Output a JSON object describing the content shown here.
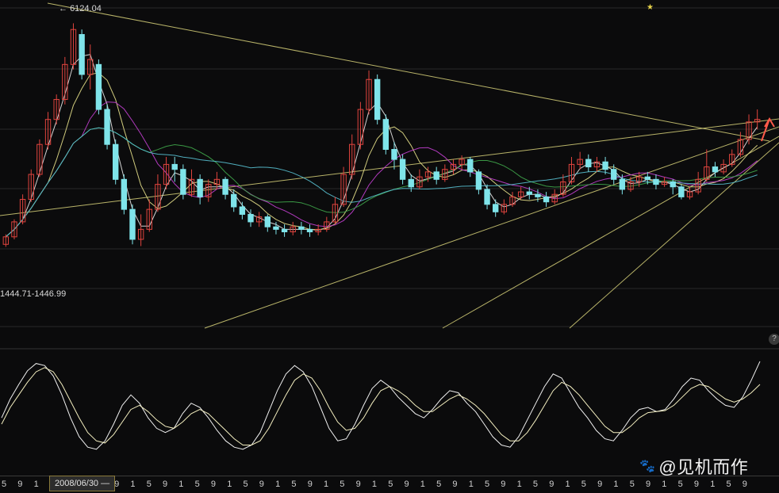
{
  "header": {
    "peak_label": "6124.04",
    "low_label": "1444.71-1446.99",
    "star": "★",
    "help": "?"
  },
  "watermark": {
    "icon": "paw-icon",
    "text": "@见机而作"
  },
  "axis": {
    "current_date": "2008/06/30 —",
    "tick_labels": [
      "5",
      "9",
      "1",
      "5",
      "9",
      "1",
      "5",
      "9",
      "1",
      "5",
      "9",
      "1",
      "5",
      "9",
      "1",
      "5",
      "9",
      "1",
      "5",
      "9",
      "1",
      "5",
      "9",
      "1",
      "5",
      "9",
      "1",
      "5",
      "9",
      "1",
      "5",
      "9",
      "1",
      "5",
      "9",
      "1",
      "5",
      "9",
      "1",
      "5",
      "9",
      "1",
      "5",
      "9",
      "1",
      "5",
      "9"
    ]
  },
  "colors": {
    "background": "#0b0b0c",
    "up": "#e0443e",
    "down": "#7fe4ea",
    "ma_white": "#e8e8e8",
    "ma_yellow": "#e6e08a",
    "ma_magenta": "#c23fd0",
    "ma_green": "#3fa64a",
    "ma_cyan": "#58c0d0",
    "trendline": "#d8d27a",
    "kdj_k": "#f0f0f0",
    "kdj_d": "#f4efc0"
  },
  "chart_data": {
    "type": "candlestick",
    "title": "",
    "annotations": [
      "6124.04",
      "1444.71-1446.99"
    ],
    "ylim": [
      800,
      6400
    ],
    "candles": [
      {
        "o": 1700,
        "c": 1850,
        "h": 1900,
        "l": 1650
      },
      {
        "o": 1850,
        "c": 2150,
        "h": 2200,
        "l": 1800
      },
      {
        "o": 2150,
        "c": 2600,
        "h": 2700,
        "l": 2100
      },
      {
        "o": 2600,
        "c": 3100,
        "h": 3200,
        "l": 2550
      },
      {
        "o": 3100,
        "c": 3700,
        "h": 3800,
        "l": 3050
      },
      {
        "o": 3700,
        "c": 4200,
        "h": 4350,
        "l": 3600
      },
      {
        "o": 4200,
        "c": 4600,
        "h": 4700,
        "l": 4100
      },
      {
        "o": 4600,
        "c": 5300,
        "h": 5450,
        "l": 4500
      },
      {
        "o": 5300,
        "c": 6000,
        "h": 6124,
        "l": 5200
      },
      {
        "o": 5900,
        "c": 5100,
        "h": 6000,
        "l": 5000
      },
      {
        "o": 5100,
        "c": 5400,
        "h": 5700,
        "l": 4800
      },
      {
        "o": 5300,
        "c": 4400,
        "h": 5400,
        "l": 4300
      },
      {
        "o": 4400,
        "c": 3700,
        "h": 4500,
        "l": 3600
      },
      {
        "o": 3700,
        "c": 3000,
        "h": 3800,
        "l": 2900
      },
      {
        "o": 3000,
        "c": 2400,
        "h": 3100,
        "l": 2300
      },
      {
        "o": 2400,
        "c": 1800,
        "h": 2500,
        "l": 1700
      },
      {
        "o": 1800,
        "c": 2000,
        "h": 2300,
        "l": 1665
      },
      {
        "o": 2000,
        "c": 2400,
        "h": 2600,
        "l": 1950
      },
      {
        "o": 2400,
        "c": 2900,
        "h": 3100,
        "l": 2350
      },
      {
        "o": 2900,
        "c": 3300,
        "h": 3450,
        "l": 2800
      },
      {
        "o": 3300,
        "c": 3200,
        "h": 3450,
        "l": 2950
      },
      {
        "o": 3200,
        "c": 2700,
        "h": 3300,
        "l": 2600
      },
      {
        "o": 2700,
        "c": 3000,
        "h": 3200,
        "l": 2650
      },
      {
        "o": 3000,
        "c": 2650,
        "h": 3100,
        "l": 2500
      },
      {
        "o": 2650,
        "c": 2900,
        "h": 3000,
        "l": 2550
      },
      {
        "o": 2900,
        "c": 3000,
        "h": 3150,
        "l": 2800
      },
      {
        "o": 3000,
        "c": 2700,
        "h": 3050,
        "l": 2600
      },
      {
        "o": 2700,
        "c": 2450,
        "h": 2800,
        "l": 2350
      },
      {
        "o": 2450,
        "c": 2300,
        "h": 2550,
        "l": 2200
      },
      {
        "o": 2300,
        "c": 2150,
        "h": 2400,
        "l": 2050
      },
      {
        "o": 2150,
        "c": 2250,
        "h": 2350,
        "l": 2050
      },
      {
        "o": 2250,
        "c": 2050,
        "h": 2300,
        "l": 1950
      },
      {
        "o": 2050,
        "c": 2000,
        "h": 2150,
        "l": 1900
      },
      {
        "o": 2000,
        "c": 1950,
        "h": 2100,
        "l": 1850
      },
      {
        "o": 1950,
        "c": 2050,
        "h": 2150,
        "l": 1880
      },
      {
        "o": 2050,
        "c": 2000,
        "h": 2150,
        "l": 1900
      },
      {
        "o": 2000,
        "c": 1950,
        "h": 2100,
        "l": 1850
      },
      {
        "o": 1950,
        "c": 2000,
        "h": 2100,
        "l": 1880
      },
      {
        "o": 2000,
        "c": 2150,
        "h": 2250,
        "l": 1950
      },
      {
        "o": 2150,
        "c": 2500,
        "h": 2650,
        "l": 2100
      },
      {
        "o": 2500,
        "c": 3100,
        "h": 3250,
        "l": 2450
      },
      {
        "o": 3100,
        "c": 3700,
        "h": 3900,
        "l": 3000
      },
      {
        "o": 3700,
        "c": 4400,
        "h": 4550,
        "l": 3600
      },
      {
        "o": 4400,
        "c": 5000,
        "h": 5180,
        "l": 4300
      },
      {
        "o": 5000,
        "c": 4200,
        "h": 5100,
        "l": 4100
      },
      {
        "o": 4200,
        "c": 3600,
        "h": 4300,
        "l": 3500
      },
      {
        "o": 3600,
        "c": 3400,
        "h": 3750,
        "l": 3200
      },
      {
        "o": 3400,
        "c": 3000,
        "h": 3500,
        "l": 2900
      },
      {
        "o": 3000,
        "c": 2850,
        "h": 3100,
        "l": 2750
      },
      {
        "o": 2850,
        "c": 3050,
        "h": 3200,
        "l": 2800
      },
      {
        "o": 3050,
        "c": 3150,
        "h": 3250,
        "l": 2950
      },
      {
        "o": 3150,
        "c": 3000,
        "h": 3250,
        "l": 2900
      },
      {
        "o": 3000,
        "c": 3200,
        "h": 3300,
        "l": 2950
      },
      {
        "o": 3200,
        "c": 3300,
        "h": 3400,
        "l": 3100
      },
      {
        "o": 3300,
        "c": 3400,
        "h": 3480,
        "l": 3200
      },
      {
        "o": 3400,
        "c": 3150,
        "h": 3450,
        "l": 3050
      },
      {
        "o": 3150,
        "c": 2800,
        "h": 3200,
        "l": 2700
      },
      {
        "o": 2800,
        "c": 2500,
        "h": 2900,
        "l": 2400
      },
      {
        "o": 2500,
        "c": 2350,
        "h": 2600,
        "l": 2250
      },
      {
        "o": 2350,
        "c": 2500,
        "h": 2600,
        "l": 2300
      },
      {
        "o": 2500,
        "c": 2650,
        "h": 2750,
        "l": 2450
      },
      {
        "o": 2650,
        "c": 2750,
        "h": 2850,
        "l": 2600
      },
      {
        "o": 2750,
        "c": 2700,
        "h": 2850,
        "l": 2600
      },
      {
        "o": 2700,
        "c": 2650,
        "h": 2800,
        "l": 2550
      },
      {
        "o": 2650,
        "c": 2550,
        "h": 2750,
        "l": 2450
      },
      {
        "o": 2550,
        "c": 2700,
        "h": 2800,
        "l": 2500
      },
      {
        "o": 2700,
        "c": 2950,
        "h": 3100,
        "l": 2650
      },
      {
        "o": 2950,
        "c": 3300,
        "h": 3450,
        "l": 2900
      },
      {
        "o": 3300,
        "c": 3400,
        "h": 3550,
        "l": 3200
      },
      {
        "o": 3400,
        "c": 3250,
        "h": 3500,
        "l": 3150
      },
      {
        "o": 3250,
        "c": 3350,
        "h": 3450,
        "l": 3150
      },
      {
        "o": 3350,
        "c": 3200,
        "h": 3450,
        "l": 3100
      },
      {
        "o": 3200,
        "c": 3000,
        "h": 3300,
        "l": 2900
      },
      {
        "o": 3000,
        "c": 2800,
        "h": 3100,
        "l": 2700
      },
      {
        "o": 2800,
        "c": 2950,
        "h": 3050,
        "l": 2750
      },
      {
        "o": 2950,
        "c": 3050,
        "h": 3150,
        "l": 2850
      },
      {
        "o": 3050,
        "c": 3000,
        "h": 3150,
        "l": 2900
      },
      {
        "o": 3000,
        "c": 2900,
        "h": 3100,
        "l": 2800
      },
      {
        "o": 2900,
        "c": 2950,
        "h": 3050,
        "l": 2850
      },
      {
        "o": 2950,
        "c": 2850,
        "h": 3000,
        "l": 2700
      },
      {
        "o": 2850,
        "c": 2650,
        "h": 2900,
        "l": 2600
      },
      {
        "o": 2650,
        "c": 2750,
        "h": 2850,
        "l": 2600
      },
      {
        "o": 2750,
        "c": 3000,
        "h": 3150,
        "l": 2700
      },
      {
        "o": 3000,
        "c": 3250,
        "h": 3600,
        "l": 2950
      },
      {
        "o": 3250,
        "c": 3150,
        "h": 3350,
        "l": 3050
      },
      {
        "o": 3150,
        "c": 3300,
        "h": 3400,
        "l": 3100
      },
      {
        "o": 3300,
        "c": 3500,
        "h": 3600,
        "l": 3250
      },
      {
        "o": 3500,
        "c": 3800,
        "h": 3950,
        "l": 3450
      },
      {
        "o": 3800,
        "c": 4150,
        "h": 4300,
        "l": 3700
      },
      {
        "o": 4150,
        "c": 4200,
        "h": 4400,
        "l": 4000
      }
    ],
    "kdj": {
      "k": [
        40,
        58,
        72,
        85,
        92,
        90,
        80,
        62,
        40,
        22,
        12,
        10,
        18,
        34,
        52,
        62,
        54,
        40,
        30,
        26,
        30,
        44,
        54,
        50,
        40,
        28,
        18,
        12,
        10,
        14,
        26,
        46,
        66,
        82,
        90,
        84,
        70,
        50,
        30,
        18,
        20,
        34,
        52,
        68,
        76,
        70,
        60,
        52,
        44,
        40,
        48,
        58,
        66,
        64,
        54,
        46,
        34,
        22,
        14,
        12,
        22,
        38,
        54,
        70,
        82,
        78,
        64,
        50,
        40,
        28,
        20,
        18,
        28,
        40,
        48,
        50,
        46,
        48,
        58,
        70,
        78,
        76,
        66,
        58,
        52,
        50,
        60,
        76,
        94
      ],
      "d": [
        34,
        50,
        62,
        74,
        84,
        88,
        84,
        72,
        56,
        40,
        26,
        18,
        16,
        24,
        36,
        48,
        52,
        46,
        38,
        32,
        30,
        36,
        44,
        48,
        44,
        36,
        28,
        20,
        14,
        14,
        18,
        30,
        46,
        62,
        76,
        82,
        78,
        66,
        50,
        36,
        28,
        30,
        40,
        54,
        66,
        70,
        66,
        60,
        52,
        46,
        46,
        52,
        58,
        62,
        58,
        52,
        44,
        34,
        24,
        18,
        18,
        26,
        38,
        52,
        66,
        74,
        70,
        62,
        52,
        42,
        32,
        26,
        26,
        32,
        40,
        45,
        46,
        47,
        52,
        60,
        68,
        72,
        70,
        64,
        58,
        55,
        58,
        64,
        72
      ]
    }
  }
}
